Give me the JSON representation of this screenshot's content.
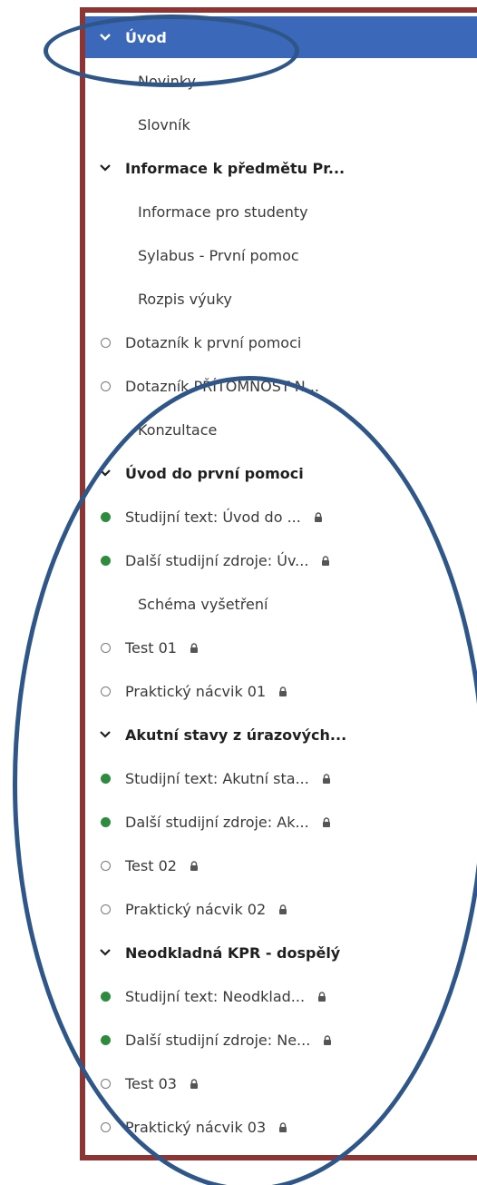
{
  "nav": {
    "items": [
      {
        "label": "Úvod",
        "kind": "active"
      },
      {
        "label": "Novinky",
        "kind": "page"
      },
      {
        "label": "Slovník",
        "kind": "page"
      },
      {
        "label": "Informace k předmětu Pr...",
        "kind": "section"
      },
      {
        "label": "Informace pro studenty",
        "kind": "page"
      },
      {
        "label": "Sylabus - První pomoc",
        "kind": "page"
      },
      {
        "label": "Rozpis výuky",
        "kind": "page"
      },
      {
        "label": "Dotazník k první pomoci",
        "kind": "todo"
      },
      {
        "label": "Dotazník PŘÍTOMNOST N...",
        "kind": "todo"
      },
      {
        "label": "Konzultace",
        "kind": "page"
      },
      {
        "label": "Úvod do první pomoci",
        "kind": "section"
      },
      {
        "label": "Studijní text: Úvod do ...",
        "kind": "done",
        "locked": true
      },
      {
        "label": "Další studijní zdroje: Úv...",
        "kind": "done",
        "locked": true
      },
      {
        "label": "Schéma vyšetření",
        "kind": "page"
      },
      {
        "label": "Test 01",
        "kind": "todo",
        "locked": true
      },
      {
        "label": "Praktický nácvik 01",
        "kind": "todo",
        "locked": true
      },
      {
        "label": "Akutní stavy z úrazových...",
        "kind": "section"
      },
      {
        "label": "Studijní text: Akutní sta...",
        "kind": "done",
        "locked": true
      },
      {
        "label": "Další studijní zdroje: Ak...",
        "kind": "done",
        "locked": true
      },
      {
        "label": "Test 02",
        "kind": "todo",
        "locked": true
      },
      {
        "label": "Praktický nácvik 02",
        "kind": "todo",
        "locked": true
      },
      {
        "label": "Neodkladná KPR - dospělý",
        "kind": "section"
      },
      {
        "label": "Studijní text: Neodklad...",
        "kind": "done",
        "locked": true
      },
      {
        "label": "Další studijní zdroje: Ne...",
        "kind": "done",
        "locked": true
      },
      {
        "label": "Test 03",
        "kind": "todo",
        "locked": true
      },
      {
        "label": "Praktický nácvik 03",
        "kind": "todo",
        "locked": true
      }
    ]
  },
  "colors": {
    "active_bg": "#3b68b8",
    "frame": "#8c3535",
    "annotation_ellipse": "#2f5688",
    "done_dot": "#2e8b3e"
  }
}
